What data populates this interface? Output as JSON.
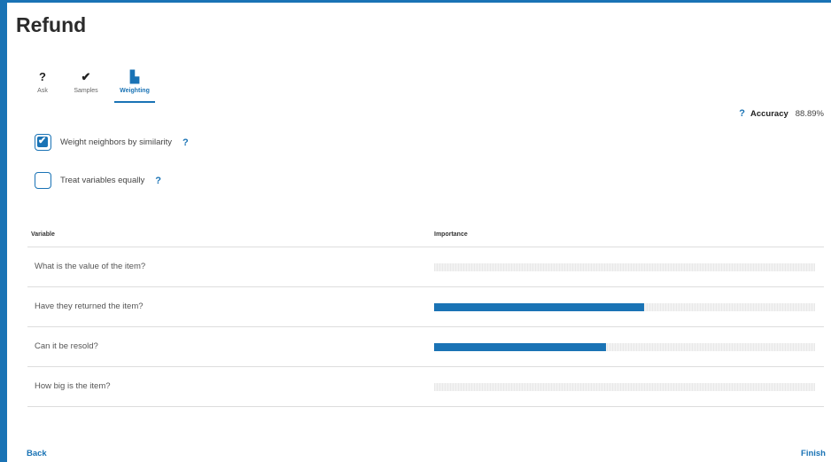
{
  "page": {
    "title": "Refund"
  },
  "steps": [
    {
      "icon": "?",
      "label": "Ask"
    },
    {
      "icon": "✔",
      "label": "Samples"
    },
    {
      "icon": "▙",
      "label": "Weighting"
    }
  ],
  "accuracy": {
    "help": "?",
    "label": "Accuracy",
    "value": "88.89%"
  },
  "options": {
    "weight_neighbors": {
      "label": "Weight neighbors by similarity",
      "checked": true,
      "help": "?"
    },
    "treat_equally": {
      "label": "Treat variables equally",
      "checked": false,
      "help": "?"
    }
  },
  "table": {
    "headers": {
      "variable": "Variable",
      "importance": "Importance"
    },
    "rows": [
      {
        "variable": "What is the value of the item?",
        "importance": 0.0
      },
      {
        "variable": "Have they returned the item?",
        "importance": 0.55
      },
      {
        "variable": "Can it be resold?",
        "importance": 0.45
      },
      {
        "variable": "How big is the item?",
        "importance": 0.0
      }
    ]
  },
  "footer": {
    "back": "Back",
    "finish": "Finish"
  },
  "colors": {
    "accent": "#1a73b5"
  }
}
